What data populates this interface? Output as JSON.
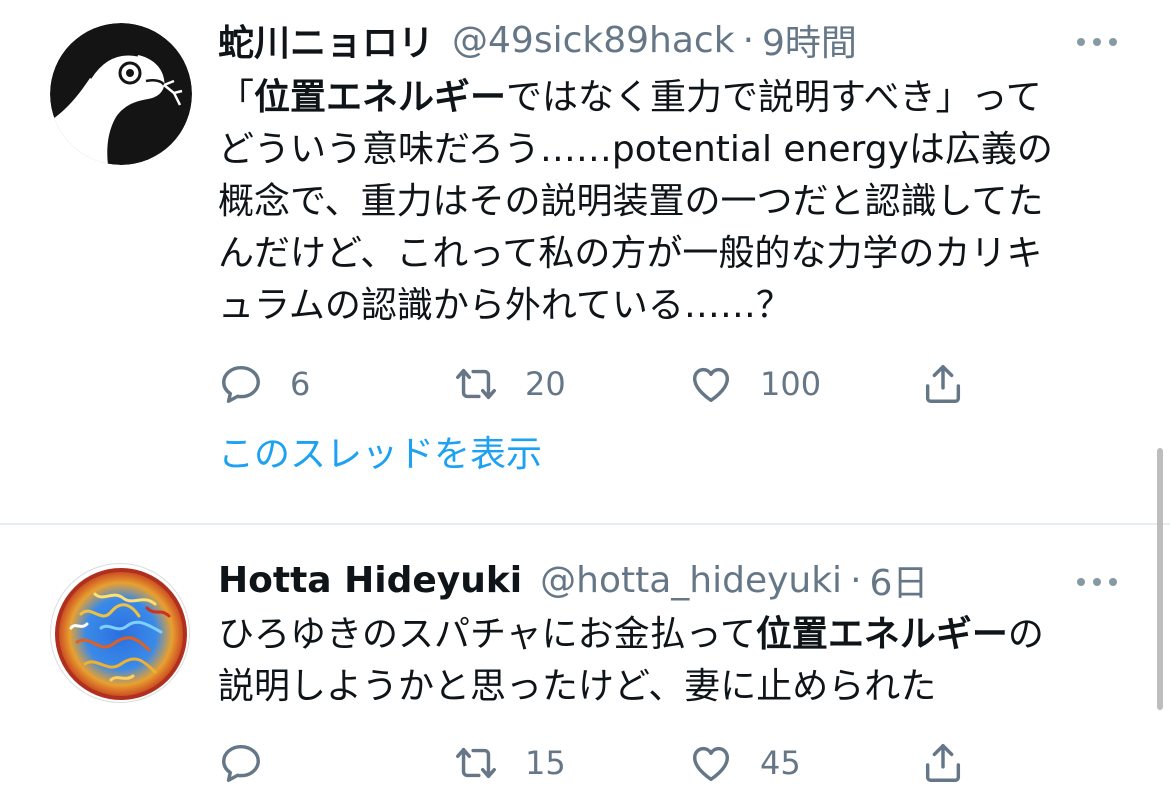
{
  "tweets": [
    {
      "name": "蛇川ニョロリ",
      "handle": "@49sick89hack",
      "separator": "·",
      "time": "9時間",
      "avatar_icon": "snake-icon",
      "lines": [
        [
          {
            "t": "「",
            "b": false
          },
          {
            "t": "位置エネルギー",
            "b": true
          },
          {
            "t": "ではなく重力で説明すべき」って",
            "b": false
          }
        ],
        [
          {
            "t": "どういう意味だろう……potential energyは広義の",
            "b": false
          }
        ],
        [
          {
            "t": "概念で、重力はその説明装置の一つだと認識してた",
            "b": false
          }
        ],
        [
          {
            "t": "んだけど、これって私の方が一般的な力学のカリキ",
            "b": false
          }
        ],
        [
          {
            "t": "ュラムの認識から外れている……？",
            "b": false
          }
        ]
      ],
      "reply_count": "6",
      "retweet_count": "20",
      "like_count": "100",
      "show_thread": "このスレッドを表示"
    },
    {
      "name": "Hotta Hideyuki",
      "handle": "@hotta_hideyuki",
      "separator": "·",
      "time": "6日",
      "avatar_icon": "fractal-pattern-avatar",
      "lines": [
        [
          {
            "t": "ひろゆきのスパチャにお金払って",
            "b": false
          },
          {
            "t": "位置エネルギー",
            "b": true
          },
          {
            "t": "の",
            "b": false
          }
        ],
        [
          {
            "t": "説明しようかと思ったけど、妻に止められた",
            "b": false
          }
        ]
      ],
      "reply_count": "",
      "retweet_count": "15",
      "like_count": "45"
    }
  ],
  "colors": {
    "text": "#0f1419",
    "secondary": "#657786",
    "link": "#1da1f2",
    "divider": "#e6ecf0"
  }
}
